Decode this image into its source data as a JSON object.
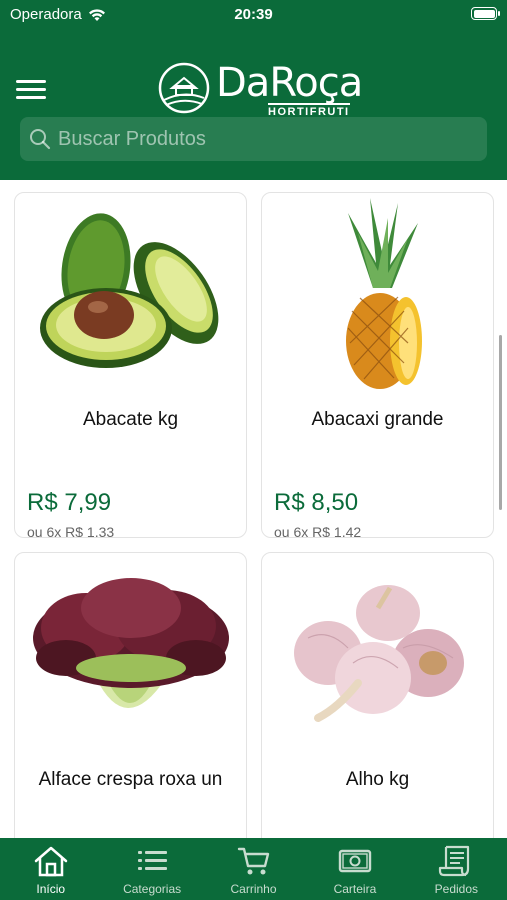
{
  "status_bar": {
    "carrier": "Operadora",
    "time": "20:39"
  },
  "header": {
    "logo_text": "DaRoça",
    "logo_subtitle": "HORTIFRUTI",
    "search_placeholder": "Buscar Produtos"
  },
  "products": [
    {
      "name": "Abacate kg",
      "price": "R$ 7,99",
      "installment": "ou 6x R$ 1,33"
    },
    {
      "name": "Abacaxi grande",
      "price": "R$ 8,50",
      "installment": "ou 6x R$ 1,42"
    },
    {
      "name": "Alface crespa roxa un",
      "price": "",
      "installment": ""
    },
    {
      "name": "Alho kg",
      "price": "",
      "installment": ""
    }
  ],
  "tabs": [
    {
      "label": "Início",
      "icon": "home-icon",
      "active": true
    },
    {
      "label": "Categorias",
      "icon": "list-icon",
      "active": false
    },
    {
      "label": "Carrinho",
      "icon": "cart-icon",
      "active": false
    },
    {
      "label": "Carteira",
      "icon": "wallet-icon",
      "active": false
    },
    {
      "label": "Pedidos",
      "icon": "receipt-icon",
      "active": false
    }
  ],
  "colors": {
    "brand_green": "#0b6b3a",
    "price_green": "#0b6b3a"
  }
}
